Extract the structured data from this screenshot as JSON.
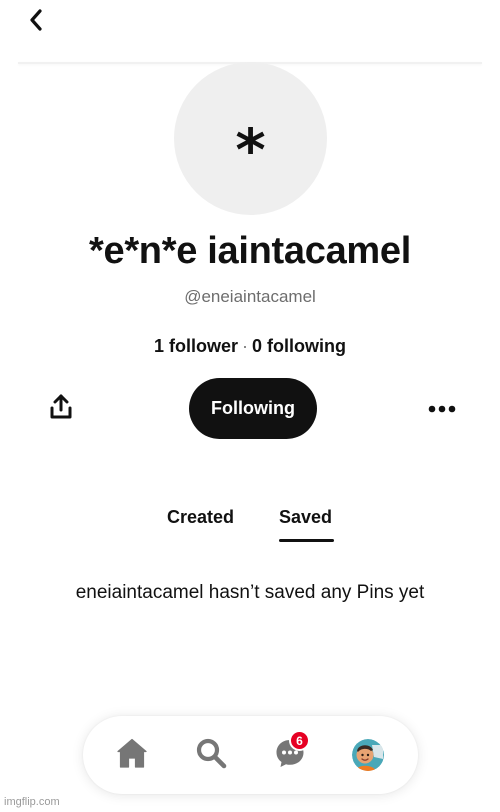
{
  "header": {
    "back_icon": "chevron-left-icon"
  },
  "profile": {
    "avatar_glyph": "*",
    "display_name": "*e*n*e iaintacamel",
    "username": "@eneiaintacamel",
    "followers_text": "1 follower",
    "separator": "·",
    "following_text": "0 following"
  },
  "actions": {
    "share_icon": "share-icon",
    "following_label": "Following",
    "more_icon": "more-icon"
  },
  "tabs": [
    {
      "label": "Created",
      "active": false
    },
    {
      "label": "Saved",
      "active": true
    }
  ],
  "empty_state": {
    "message": "eneiaintacamel hasn’t saved any Pins yet"
  },
  "bottom_nav": {
    "items": [
      {
        "icon": "home-icon"
      },
      {
        "icon": "search-icon"
      },
      {
        "icon": "messages-icon",
        "badge": "6"
      },
      {
        "icon": "profile-avatar"
      }
    ]
  },
  "watermark": "imgflip.com",
  "colors": {
    "primary_text": "#111111",
    "secondary_text": "#6d6d6d",
    "avatar_bg": "#efefef",
    "button_bg": "#111111",
    "badge_bg": "#e60023"
  }
}
